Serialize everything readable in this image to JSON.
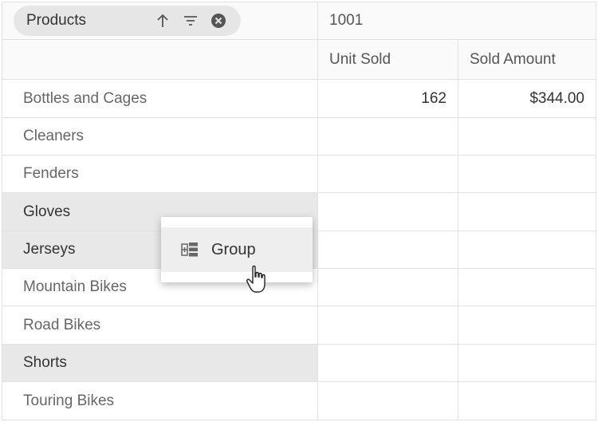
{
  "pivot": {
    "filter_chip": {
      "label": "Products",
      "icons": [
        "sort-ascending-icon",
        "filter-icon",
        "remove-icon"
      ]
    },
    "column_group": "1001",
    "columns": [
      "Unit Sold",
      "Sold Amount"
    ],
    "rows": [
      {
        "label": "Bottles and Cages",
        "unit_sold": "162",
        "sold_amount": "$344.00",
        "selected": false
      },
      {
        "label": "Cleaners",
        "unit_sold": "",
        "sold_amount": "",
        "selected": false
      },
      {
        "label": "Fenders",
        "unit_sold": "",
        "sold_amount": "",
        "selected": false
      },
      {
        "label": "Gloves",
        "unit_sold": "",
        "sold_amount": "",
        "selected": true
      },
      {
        "label": "Jerseys",
        "unit_sold": "",
        "sold_amount": "",
        "selected": true
      },
      {
        "label": "Mountain Bikes",
        "unit_sold": "",
        "sold_amount": "",
        "selected": false
      },
      {
        "label": "Road Bikes",
        "unit_sold": "",
        "sold_amount": "",
        "selected": false
      },
      {
        "label": "Shorts",
        "unit_sold": "",
        "sold_amount": "",
        "selected": true
      },
      {
        "label": "Touring Bikes",
        "unit_sold": "",
        "sold_amount": "",
        "selected": false
      }
    ]
  },
  "context_menu": {
    "items": [
      {
        "label": "Group",
        "icon": "group-icon"
      }
    ]
  },
  "colors": {
    "selected_row": "#e8e8e8",
    "chip_bg": "#e6e6e6",
    "border": "#e2e2e2"
  }
}
